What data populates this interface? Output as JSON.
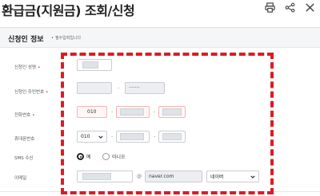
{
  "page": {
    "title": "환급금(지원금) 조회/신청",
    "icons": [
      "print-icon",
      "share-icon",
      "close-icon"
    ]
  },
  "section": {
    "title": "신청인 정보",
    "required_note": "필수입력입니다",
    "required_mark": "•"
  },
  "form": {
    "name_label": "신청인 성명",
    "rrn_label": "신청인 주민번호",
    "rrn_back_value": "·······",
    "phone_label": "전화번호",
    "phone_prefix": "010",
    "mobile_label": "휴대폰번호",
    "mobile_prefix_selected": "010",
    "sms_label": "SMS 수신",
    "sms_yes": "예",
    "sms_no": "아니오",
    "sms_selected": "예",
    "email_label": "이메일",
    "email_domain": "naver.com",
    "email_domain_select": "네이버",
    "separator": "-",
    "at_symbol": "@"
  },
  "colors": {
    "highlight": "#e01921",
    "required": "#d51f2a",
    "error_border": "#f1b5b5"
  }
}
